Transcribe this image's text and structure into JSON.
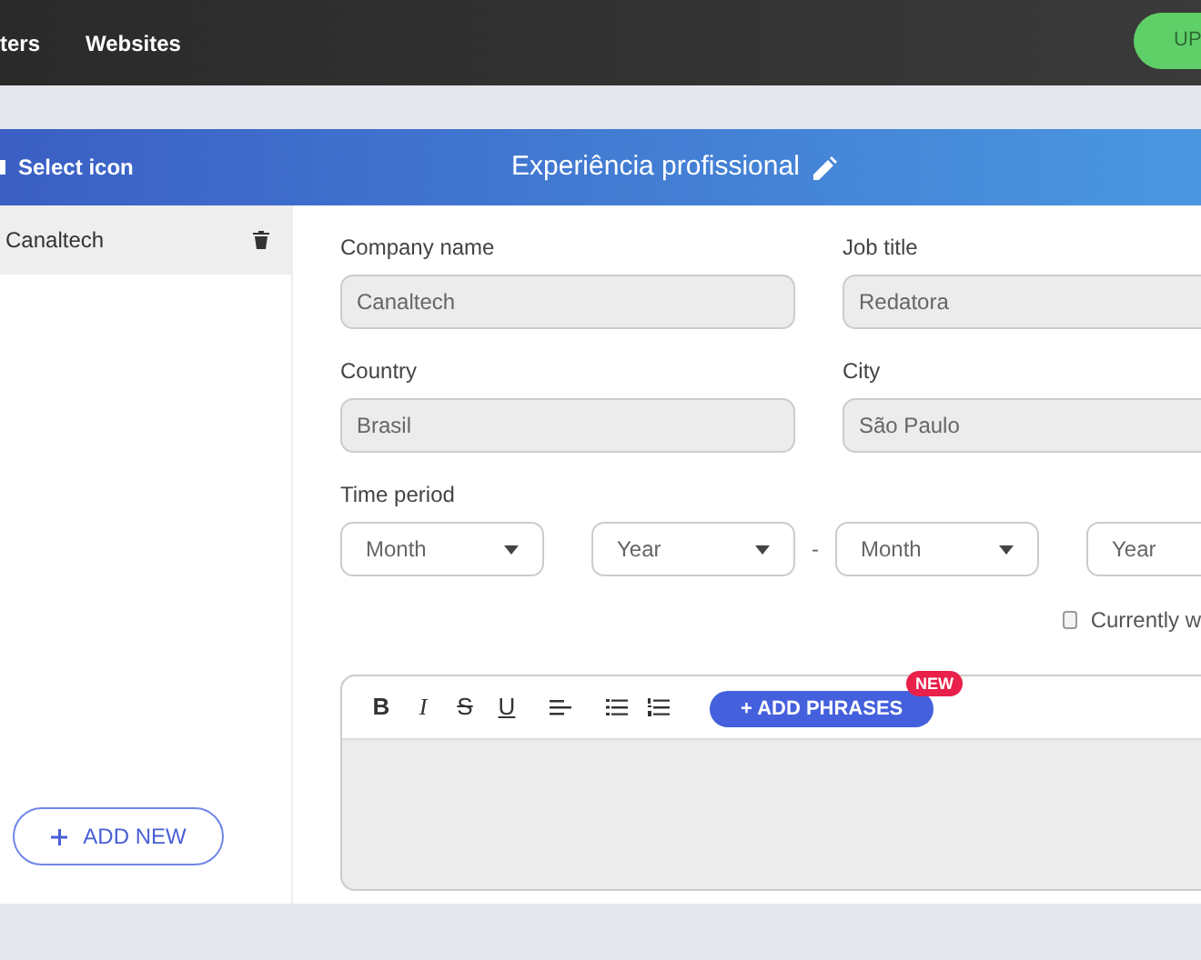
{
  "top_nav": {
    "links": [
      "ters",
      "Websites"
    ],
    "button": "UP"
  },
  "panel": {
    "select_icon": "Select icon",
    "title": "Experiência profissional"
  },
  "sidebar": {
    "items": [
      {
        "label": "Canaltech",
        "selected": true
      }
    ],
    "add_button": "ADD NEW"
  },
  "form": {
    "fields": [
      {
        "label": "Company name",
        "value": "Canaltech"
      },
      {
        "label": "Job title",
        "value": "Redatora"
      },
      {
        "label": "Country",
        "value": "Brasil"
      },
      {
        "label": "City",
        "value": "São Paulo"
      }
    ],
    "time_period": {
      "label": "Time period",
      "selects": [
        "Month",
        "Year",
        "Month",
        "Year"
      ],
      "separator": "-"
    },
    "currently": {
      "label": "Currently w",
      "checked": false
    }
  },
  "editor": {
    "tools": [
      {
        "kind": "bold",
        "label": "B"
      },
      {
        "kind": "italic",
        "label": "I"
      },
      {
        "kind": "strike",
        "label": "S"
      },
      {
        "kind": "underline",
        "label": "U"
      },
      {
        "kind": "align"
      },
      {
        "kind": "bullets"
      },
      {
        "kind": "numbers"
      }
    ],
    "add_phrases": "+ ADD PHRASES",
    "badge": "NEW"
  }
}
